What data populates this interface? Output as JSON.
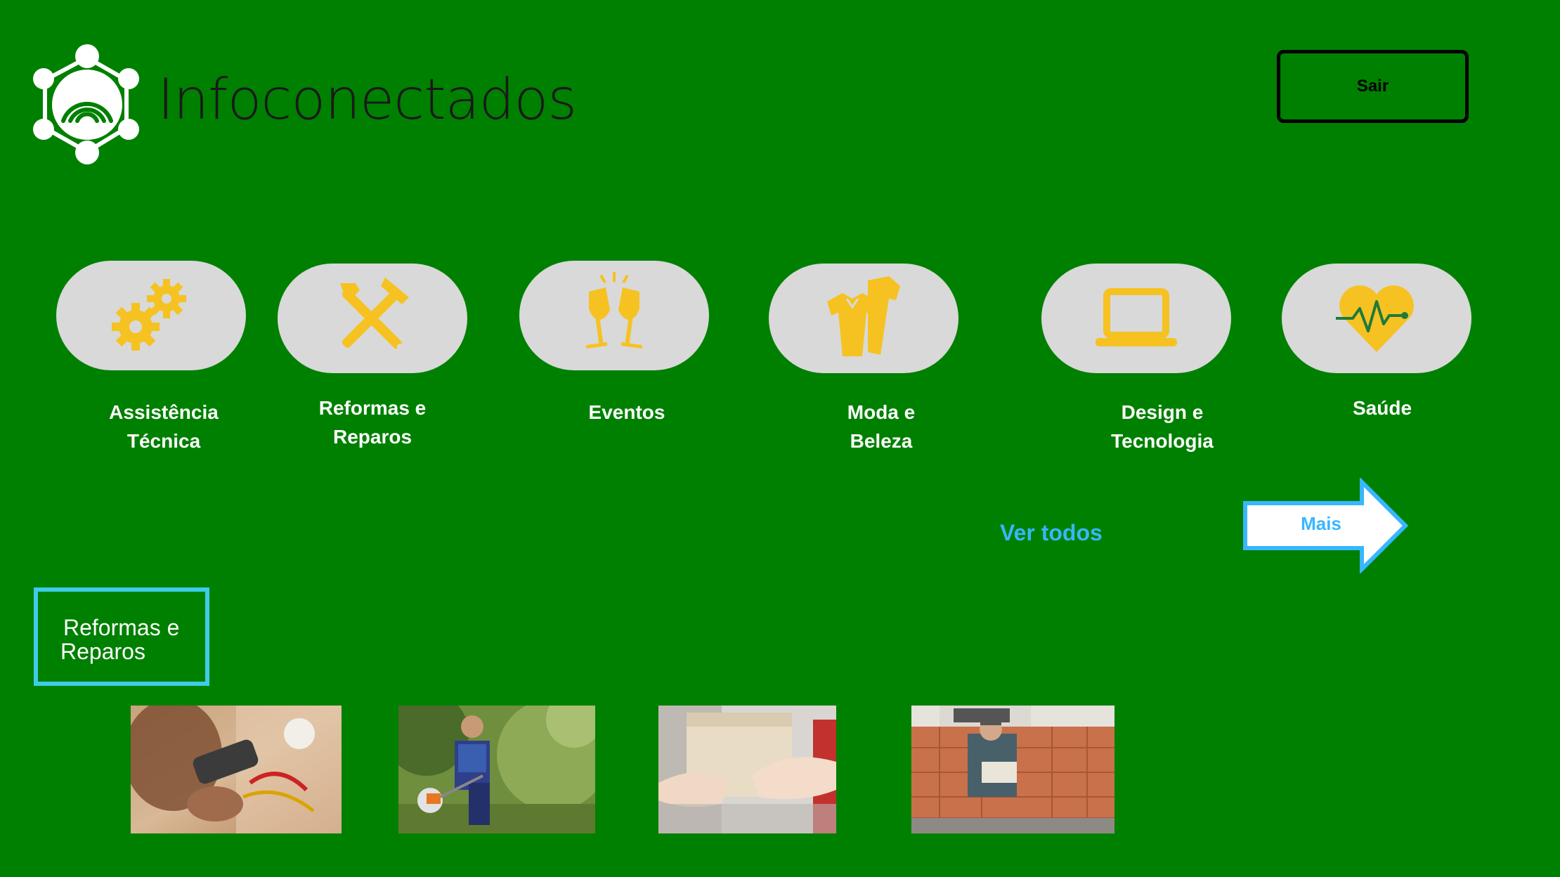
{
  "header": {
    "brand": "Infoconectados",
    "logout_label": "Sair"
  },
  "categories": [
    {
      "label_line1": "Assistência",
      "label_line2": "Técnica",
      "icon": "gears-icon"
    },
    {
      "label_line1": "Reformas e",
      "label_line2": "Reparos",
      "icon": "tools-icon"
    },
    {
      "label_line1": "Eventos",
      "label_line2": "",
      "icon": "champagne-icon"
    },
    {
      "label_line1": "Moda e",
      "label_line2": "Beleza",
      "icon": "clothing-icon"
    },
    {
      "label_line1": "Design e",
      "label_line2": "Tecnologia",
      "icon": "laptop-icon"
    },
    {
      "label_line1": "Saúde",
      "label_line2": "",
      "icon": "heart-pulse-icon"
    }
  ],
  "navigation": {
    "see_all": "Ver todos",
    "more": "Mais"
  },
  "section": {
    "title_line1": "Reformas e",
    "title_line2": "Reparos",
    "photos": [
      {
        "subject": "electrician-wiring-photo"
      },
      {
        "subject": "gardener-trimmer-photo"
      },
      {
        "subject": "package-handoff-photo"
      },
      {
        "subject": "bricklayer-photo"
      }
    ]
  },
  "colors": {
    "background": "#008000",
    "pill": "#d9d9d9",
    "icon": "#f6c221",
    "accent_blue": "#38b6ff",
    "section_border": "#3ecce8"
  }
}
